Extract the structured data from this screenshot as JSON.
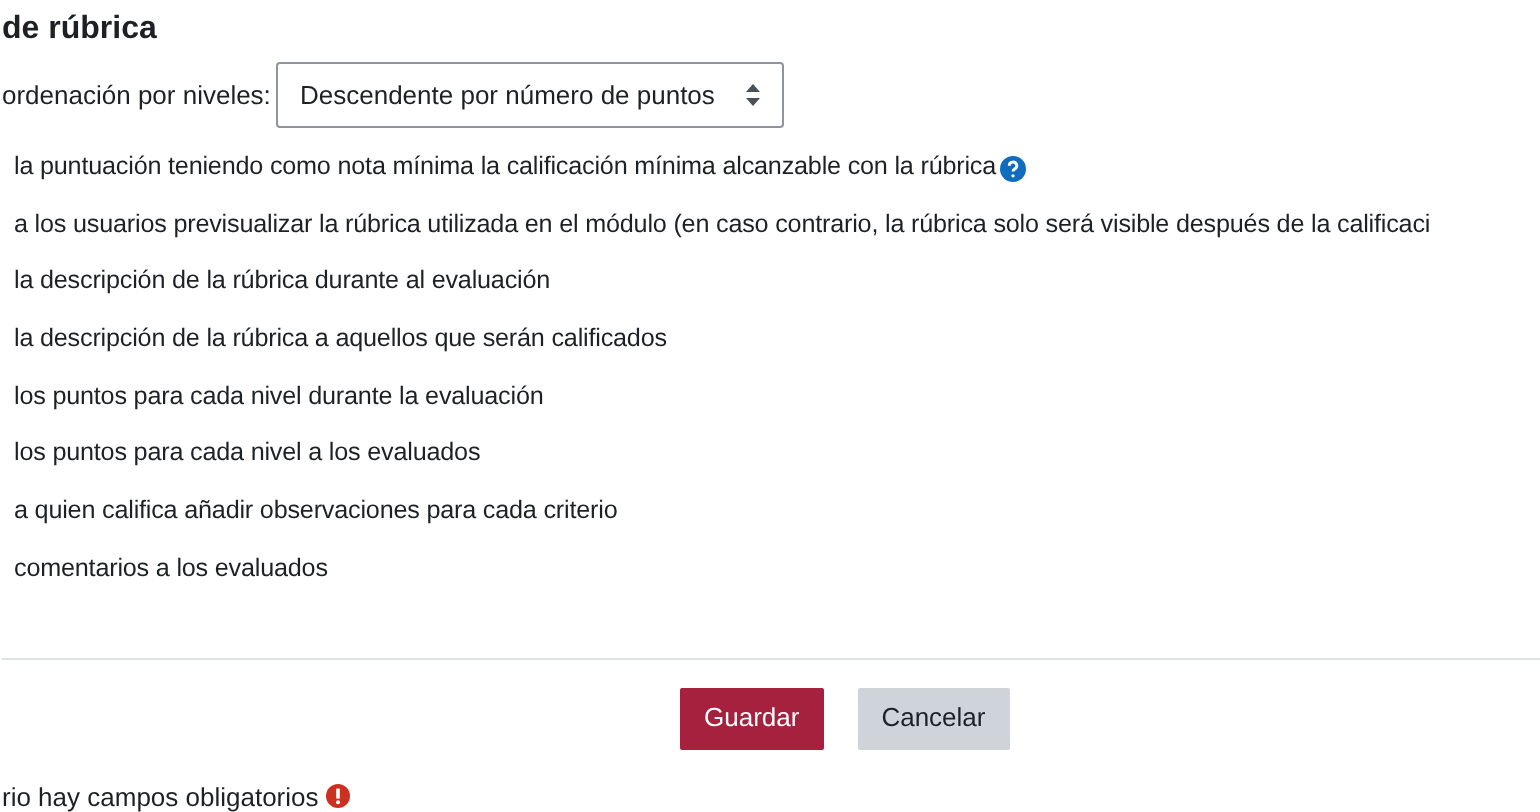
{
  "heading": "de rúbrica",
  "sort": {
    "label": "ordenación por niveles:",
    "value": "Descendente por número de puntos"
  },
  "options": [
    {
      "text": "la puntuación teniendo como nota mínima la calificación mínima alcanzable con la rúbrica",
      "help": true
    },
    {
      "text": "a los usuarios previsualizar la rúbrica utilizada en el módulo (en caso contrario, la rúbrica solo será visible después de la calificaci",
      "help": false
    },
    {
      "text": "la descripción de la rúbrica durante al evaluación",
      "help": false
    },
    {
      "text": "la descripción de la rúbrica a aquellos que serán calificados",
      "help": false
    },
    {
      "text": "los puntos para cada nivel durante la evaluación",
      "help": false
    },
    {
      "text": "los puntos para cada nivel a los evaluados",
      "help": false
    },
    {
      "text": "a quien califica añadir observaciones para cada criterio",
      "help": false
    },
    {
      "text": "comentarios a los evaluados",
      "help": false
    }
  ],
  "buttons": [
    {
      "label": "Guardar",
      "kind": "primary"
    },
    {
      "label": "Cancelar",
      "kind": "secondary"
    }
  ],
  "required_note": "rio hay campos obligatorios"
}
